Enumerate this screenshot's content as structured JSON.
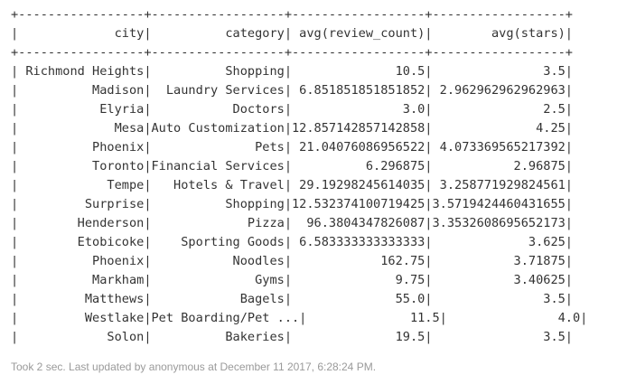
{
  "table": {
    "columns": [
      {
        "name": "city",
        "width": 17
      },
      {
        "name": "category",
        "width": 18
      },
      {
        "name": "avg(review_count)",
        "width": 18
      },
      {
        "name": "avg(stars)",
        "width": 18
      }
    ],
    "rows": [
      [
        "Richmond Heights",
        "Shopping",
        "10.5",
        "3.5"
      ],
      [
        "Madison",
        "Laundry Services",
        "6.851851851851852",
        "2.962962962962963"
      ],
      [
        "Elyria",
        "Doctors",
        "3.0",
        "2.5"
      ],
      [
        "Mesa",
        "Auto Customization",
        "12.857142857142858",
        "4.25"
      ],
      [
        "Phoenix",
        "Pets",
        "21.04076086956522",
        "4.073369565217392"
      ],
      [
        "Toronto",
        "Financial Services",
        "6.296875",
        "2.96875"
      ],
      [
        "Tempe",
        "Hotels & Travel",
        "29.19298245614035",
        "3.258771929824561"
      ],
      [
        "Surprise",
        "Shopping",
        "12.532374100719425",
        "3.5719424460431655"
      ],
      [
        "Henderson",
        "Pizza",
        "96.3804347826087",
        "3.3532608695652173"
      ],
      [
        "Etobicoke",
        "Sporting Goods",
        "6.583333333333333",
        "3.625"
      ],
      [
        "Phoenix",
        "Noodles",
        "162.75",
        "3.71875"
      ],
      [
        "Markham",
        "Gyms",
        "9.75",
        "3.40625"
      ],
      [
        "Matthews",
        "Bagels",
        "55.0",
        "3.5"
      ],
      [
        "Westlake",
        "Pet Boarding/Pet ...",
        "11.5",
        "4.0"
      ],
      [
        "Solon",
        "Bakeries",
        "19.5",
        "3.5"
      ]
    ]
  },
  "status": "Took 2 sec. Last updated by anonymous at December 11 2017, 6:28:24 PM."
}
